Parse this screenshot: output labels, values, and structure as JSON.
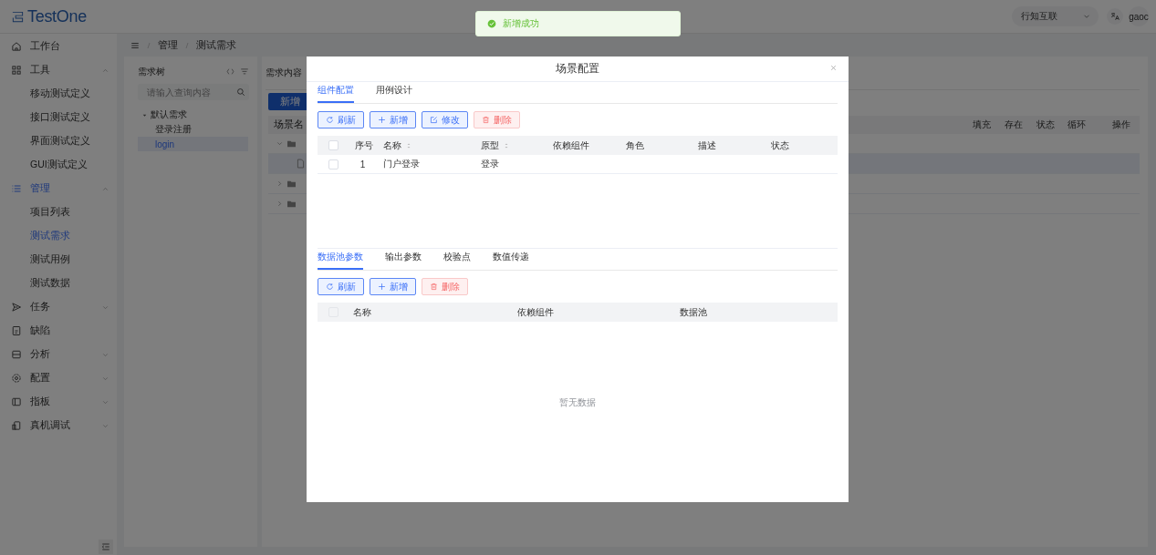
{
  "header": {
    "logo": "TestOne",
    "org_select": "行知互联",
    "user": "gaoc"
  },
  "sidebar": {
    "items": [
      {
        "label": "工作台",
        "selected": false
      },
      {
        "label": "工具",
        "selected": false,
        "expanded": true,
        "children": [
          {
            "label": "移动测试定义",
            "selected": false
          },
          {
            "label": "接口测试定义",
            "selected": false
          },
          {
            "label": "界面测试定义",
            "selected": false
          },
          {
            "label": "GUI测试定义",
            "selected": false
          }
        ]
      },
      {
        "label": "管理",
        "selected": true,
        "expanded": true,
        "children": [
          {
            "label": "项目列表",
            "selected": false
          },
          {
            "label": "测试需求",
            "selected": true
          },
          {
            "label": "测试用例",
            "selected": false
          },
          {
            "label": "测试数据",
            "selected": false
          }
        ]
      },
      {
        "label": "任务",
        "selected": false,
        "expanded": false
      },
      {
        "label": "缺陷",
        "selected": false
      },
      {
        "label": "分析",
        "selected": false,
        "expanded": false
      },
      {
        "label": "配置",
        "selected": false,
        "expanded": false
      },
      {
        "label": "指板",
        "selected": false,
        "expanded": false
      },
      {
        "label": "真机调试",
        "selected": false,
        "expanded": false
      }
    ]
  },
  "breadcrumb": [
    "管理",
    "测试需求"
  ],
  "tree_panel": {
    "title": "需求树",
    "search": {
      "placeholder": "请输入查询内容"
    },
    "tree": [
      {
        "label": "默认需求",
        "expanded": true,
        "selected": false,
        "children": [
          {
            "label": "登录注册",
            "selected": false
          },
          {
            "label": "login",
            "selected": true
          }
        ]
      }
    ]
  },
  "content_panel": {
    "title": "需求内容",
    "add_button": "新增",
    "columns": [
      "场景名",
      "填充",
      "存在",
      "状态",
      "循环",
      "操作"
    ],
    "rows": [
      {
        "expanded": true,
        "children": [
          {
            "selected": true
          }
        ]
      },
      {
        "expanded": false
      },
      {
        "expanded": false
      }
    ]
  },
  "modal": {
    "title": "场景配置",
    "component_tabs": [
      {
        "label": "组件配置",
        "selected": true
      },
      {
        "label": "用例设计",
        "selected": false
      }
    ],
    "component_toolbar": [
      {
        "label": "刷新",
        "kind": "refresh"
      },
      {
        "label": "新增",
        "kind": "add"
      },
      {
        "label": "修改",
        "kind": "edit"
      },
      {
        "label": "删除",
        "kind": "delete"
      }
    ],
    "component_table": {
      "all_checked": false,
      "columns": [
        {
          "label": "序号",
          "sortable": false
        },
        {
          "label": "名称",
          "sortable": true
        },
        {
          "label": "原型",
          "sortable": true
        },
        {
          "label": "依赖组件",
          "sortable": false
        },
        {
          "label": "角色",
          "sortable": false
        },
        {
          "label": "描述",
          "sortable": false
        },
        {
          "label": "状态",
          "sortable": false
        }
      ],
      "rows": [
        {
          "checked": false,
          "index": "1",
          "name": "门户登录",
          "prototype": "登录"
        }
      ]
    },
    "param_tabs": [
      {
        "label": "数据池参数",
        "selected": true
      },
      {
        "label": "输出参数",
        "selected": false
      },
      {
        "label": "校验点",
        "selected": false
      },
      {
        "label": "数值传递",
        "selected": false
      }
    ],
    "param_toolbar": [
      {
        "label": "刷新",
        "kind": "refresh"
      },
      {
        "label": "新增",
        "kind": "add"
      },
      {
        "label": "删除",
        "kind": "delete"
      }
    ],
    "param_table": {
      "all_checked": false,
      "columns": [
        "名称",
        "依赖组件",
        "数据池"
      ],
      "empty_text": "暂无数据"
    }
  },
  "toast": {
    "kind": "success",
    "message": "新增成功"
  }
}
